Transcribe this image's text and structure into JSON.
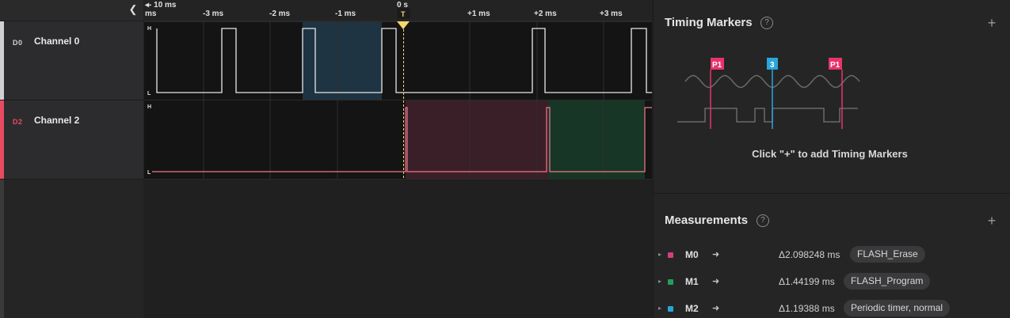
{
  "timeline": {
    "start_label": "◂- 10 ms",
    "ticks": [
      "ms",
      "-3 ms",
      "-2 ms",
      "-1 ms",
      "0 s",
      "+1 ms",
      "+2 ms",
      "+3 ms"
    ],
    "trigger_label": "T"
  },
  "channels": [
    {
      "id": "D0",
      "name": "Channel 0",
      "color": "#d0d0d0",
      "high_label": "H",
      "low_label": "L"
    },
    {
      "id": "D2",
      "name": "Channel 2",
      "color": "#e84a5f",
      "high_label": "H",
      "low_label": "L"
    }
  ],
  "timing_markers": {
    "title": "Timing Markers",
    "help_icon": "question-circle-icon",
    "add_icon": "plus-icon",
    "illustration_labels": [
      "P1",
      "3",
      "P1"
    ],
    "hint": "Click \"+\" to add Timing Markers"
  },
  "measurements": {
    "title": "Measurements",
    "help_icon": "question-circle-icon",
    "add_icon": "plus-icon",
    "items": [
      {
        "name": "M0",
        "color": "#d43f7f",
        "delta": "Δ2.098248 ms",
        "tag": "FLASH_Erase"
      },
      {
        "name": "M1",
        "color": "#22a05a",
        "delta": "Δ1.44199 ms",
        "tag": "FLASH_Program"
      },
      {
        "name": "M2",
        "color": "#2aa6d8",
        "delta": "Δ1.19388 ms",
        "tag": "Periodic timer, normal"
      }
    ]
  },
  "colors": {
    "accent_trigger": "#f5d76e",
    "ch0_region": "#1f3442",
    "ch2_region_red": "#3a1f28",
    "ch2_region_green": "#173625"
  }
}
